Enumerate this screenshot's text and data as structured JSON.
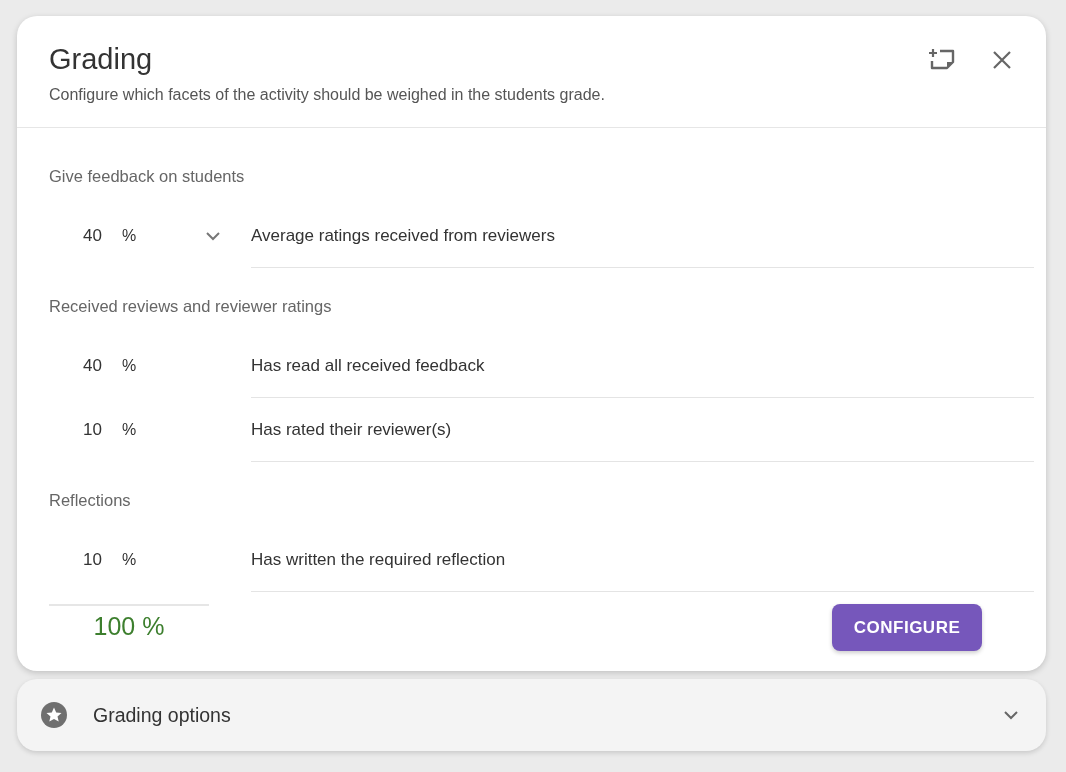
{
  "dialog": {
    "title": "Grading",
    "subtitle": "Configure which facets of the activity should be weighed in the students grade."
  },
  "sections": [
    {
      "label": "Give feedback on students",
      "rows": [
        {
          "value": "40",
          "unit": "%",
          "dropdown": true,
          "description": "Average ratings received from reviewers"
        }
      ]
    },
    {
      "label": "Received reviews and reviewer ratings",
      "rows": [
        {
          "value": "40",
          "unit": "%",
          "dropdown": false,
          "description": "Has read all received feedback"
        },
        {
          "value": "10",
          "unit": "%",
          "dropdown": false,
          "description": "Has rated their reviewer(s)"
        }
      ]
    },
    {
      "label": "Reflections",
      "rows": [
        {
          "value": "10",
          "unit": "%",
          "dropdown": false,
          "description": "Has written the required reflection"
        }
      ]
    }
  ],
  "total": "100 %",
  "configure_button": "CONFIGURE",
  "options_panel": {
    "label": "Grading options",
    "expanded": false
  }
}
